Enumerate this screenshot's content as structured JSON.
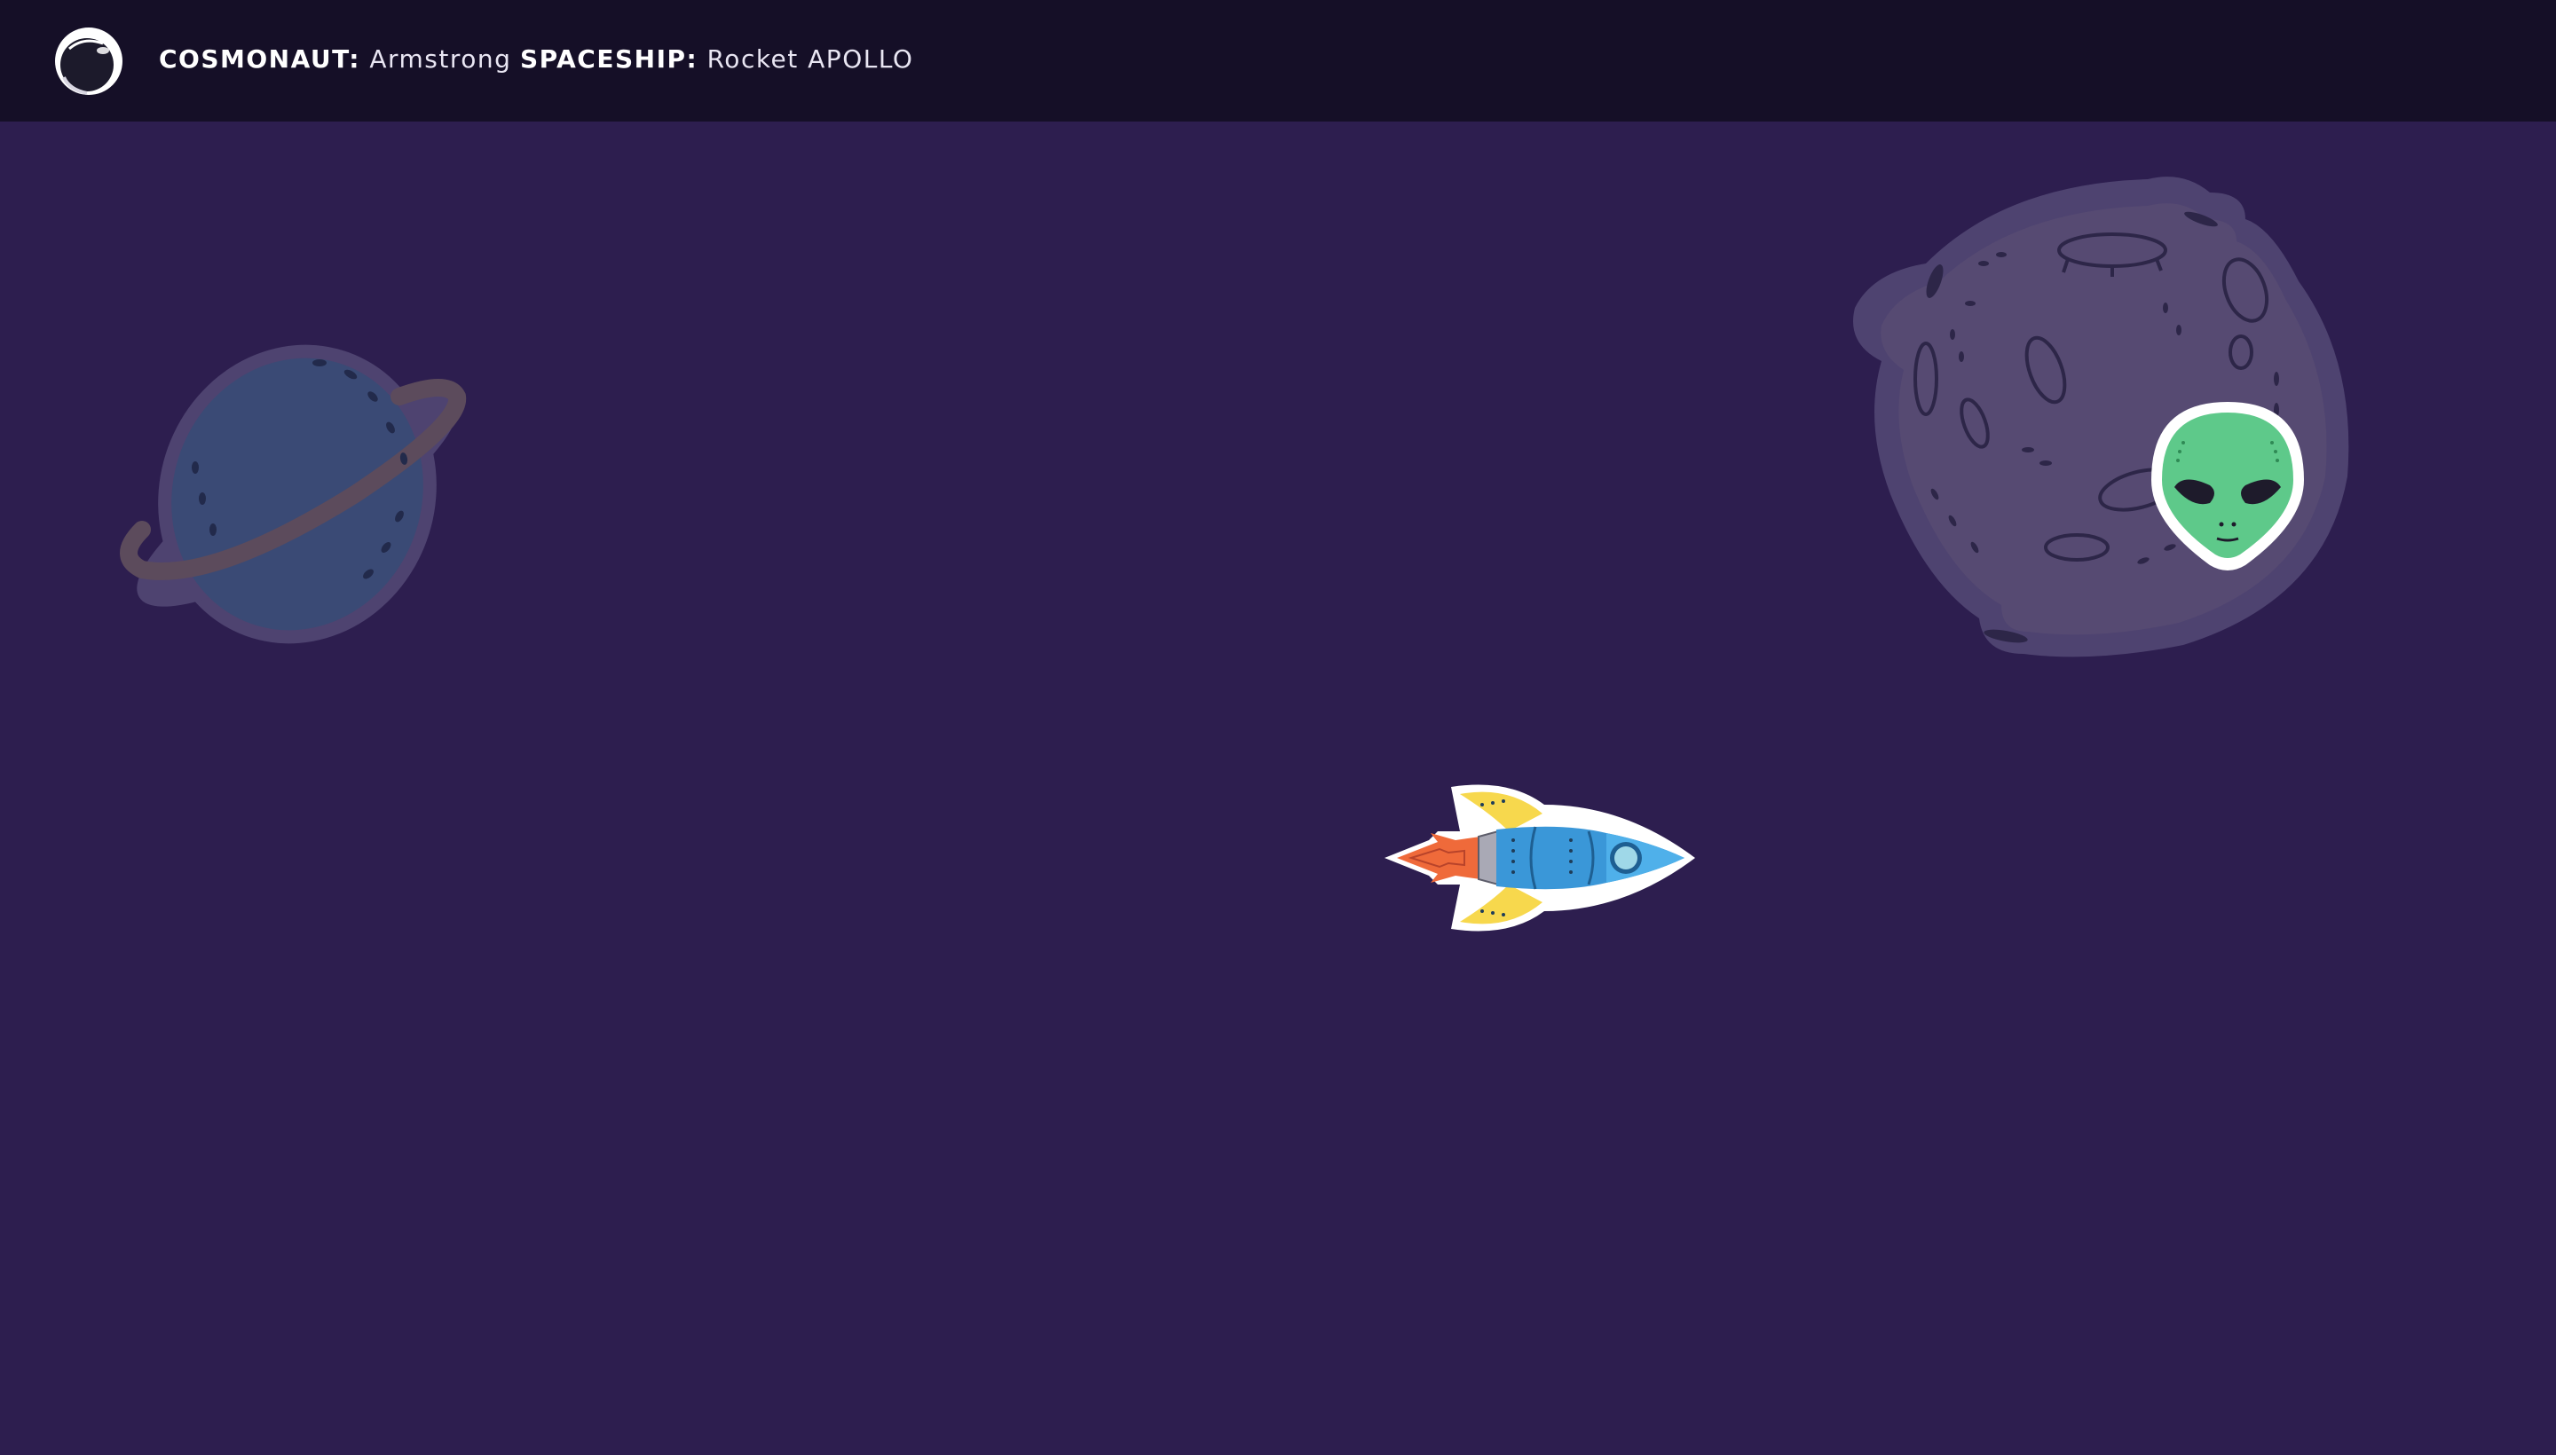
{
  "header": {
    "cosmonaut_label": "COSMONAUT:",
    "cosmonaut_name": "Armstrong",
    "spaceship_label": "SPACESHIP:",
    "spaceship_name": "Rocket APOLLO"
  },
  "colors": {
    "header_bg": "#150f27",
    "space_bg": "#2d1e4f",
    "planet_body": "#3a4a75",
    "planet_ring": "#5c4b5c",
    "moon_body": "#564a72",
    "alien_skin": "#5ec98a",
    "rocket_body": "#3a97d8",
    "rocket_wings": "#f7d84d",
    "rocket_flame": "#ef6a3a"
  },
  "icons": {
    "avatar": "astronaut-helmet-icon",
    "planet": "ringed-planet-icon",
    "moon": "cratered-moon-icon",
    "alien": "alien-head-icon",
    "player": "rocket-ship-icon"
  }
}
